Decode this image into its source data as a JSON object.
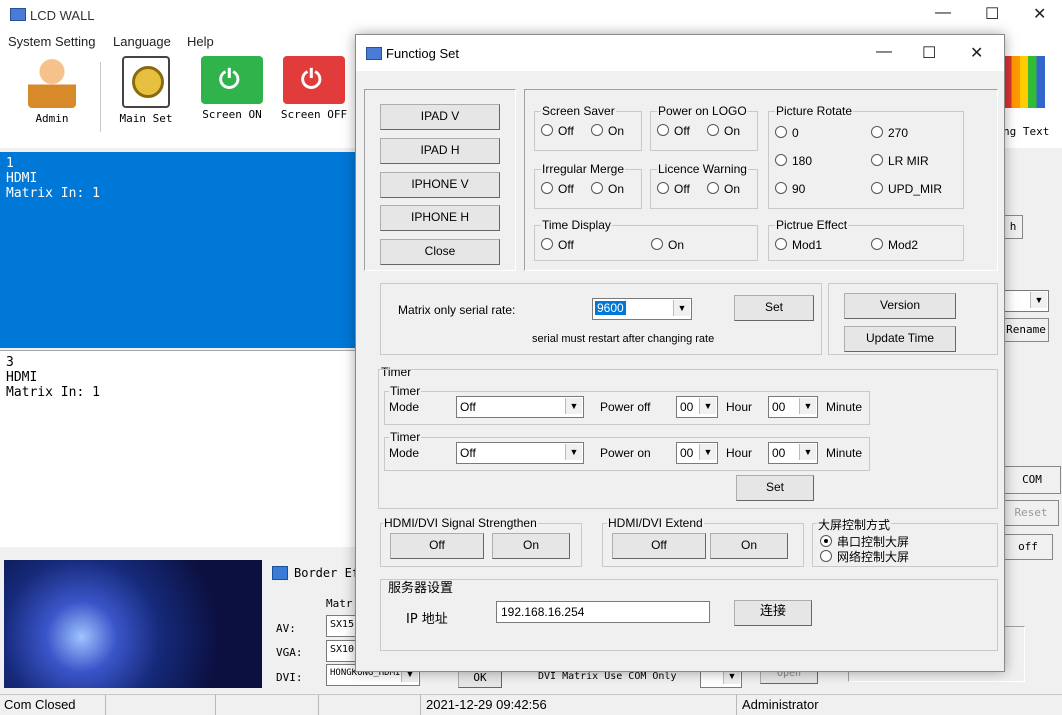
{
  "app": {
    "title": "LCD WALL",
    "menu": [
      "System Setting",
      "Language",
      "Help"
    ],
    "toolbar": [
      {
        "label": "Admin",
        "icon": "admin-user-icon",
        "color": "#f0a030"
      },
      {
        "label": "Main Set",
        "icon": "main-set-gear-icon",
        "color": "#e8c040"
      },
      {
        "label": "Screen ON",
        "icon": "screen-on-plug-icon",
        "color": "#2fb34a"
      },
      {
        "label": "Screen OFF",
        "icon": "screen-off-plug-icon",
        "color": "#e23b3b"
      }
    ],
    "right_toolbar_label": "ng Text",
    "right_buttons": {
      "h": "h",
      "rename": "Rename",
      "com": "COM",
      "reset": "Reset",
      "off": "off"
    },
    "panels": [
      {
        "text": "1\nHDMI\nMatrix In: 1"
      },
      {
        "text": "3\nHDMI\nMatrix In: 1"
      }
    ],
    "bottom": {
      "border_label": "Border Ef",
      "matrix_label": "Matr",
      "av_label": "AV:",
      "av_value": "SX15",
      "vga_label": "VGA:",
      "vga_value": "SX10",
      "dvi_label": "DVI:",
      "dvi_value": "HONGKONG_HDMI",
      "ok": "OK",
      "dvi_matrix": "DVI Matrix Use COM Only",
      "open": "Open"
    },
    "status": {
      "com": "Com Closed",
      "datetime": "2021-12-29 09:42:56",
      "user": "Administrator"
    }
  },
  "dialog": {
    "title": "Functiog Set",
    "left_buttons": [
      "IPAD V",
      "IPAD H",
      "IPHONE V",
      "IPHONE H",
      "Close"
    ],
    "screen_saver": {
      "title": "Screen Saver",
      "off": "Off",
      "on": "On"
    },
    "power_logo": {
      "title": "Power on LOGO",
      "off": "Off",
      "on": "On"
    },
    "irregular_merge": {
      "title": "Irregular Merge",
      "off": "Off",
      "on": "On"
    },
    "licence_warning": {
      "title": "Licence Warning",
      "off": "Off",
      "on": "On"
    },
    "time_display": {
      "title": "Time Display",
      "off": "Off",
      "on": "On"
    },
    "picture_rotate": {
      "title": "Picture Rotate",
      "options": [
        "0",
        "270",
        "180",
        "LR MIR",
        "90",
        "UPD_MIR"
      ]
    },
    "picture_effect": {
      "title": "Pictrue Effect",
      "options": [
        "Mod1",
        "Mod2"
      ]
    },
    "serial": {
      "label": "Matrix only serial rate:",
      "value": "9600",
      "set": "Set",
      "note": "serial must restart after changing rate"
    },
    "version": "Version",
    "update_time": "Update Time",
    "timer": {
      "title": "Timer",
      "rows": [
        {
          "group": "Timer",
          "mode_label": "Mode",
          "mode": "Off",
          "action": "Power off",
          "hour": "00",
          "hour_label": "Hour",
          "minute": "00",
          "minute_label": "Minute"
        },
        {
          "group": "Timer",
          "mode_label": "Mode",
          "mode": "Off",
          "action": "Power on",
          "hour": "00",
          "hour_label": "Hour",
          "minute": "00",
          "minute_label": "Minute"
        }
      ],
      "set": "Set"
    },
    "hdmi_strengthen": {
      "title": "HDMI/DVI Signal Strengthen",
      "off": "Off",
      "on": "On"
    },
    "hdmi_extend": {
      "title": "HDMI/DVI Extend",
      "off": "Off",
      "on": "On"
    },
    "control_mode": {
      "title": "大屏控制方式",
      "serial": "串口控制大屏",
      "network": "网络控制大屏"
    },
    "server": {
      "title": "服务器设置",
      "ip_label": "IP 地址",
      "ip": "192.168.16.254",
      "connect": "连接"
    }
  }
}
